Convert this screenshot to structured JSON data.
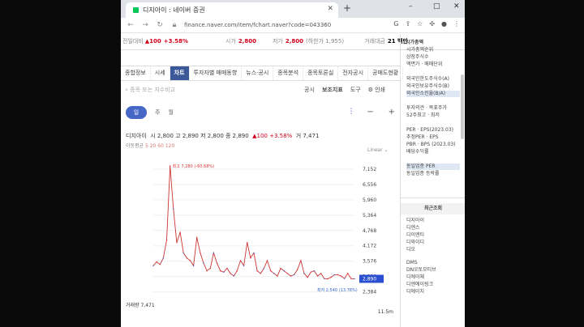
{
  "browser": {
    "tab_title": "디지아이 : 네이버 증권",
    "url": "finance.naver.com/item/fchart.naver?code=043360",
    "new_tab": "+",
    "min": "–",
    "max": "□",
    "close": "✕"
  },
  "header": {
    "prev_close_label": "전일대비",
    "prev_change": "▲100",
    "prev_change_pct": "+3.58%",
    "high_label": "시가",
    "high_value": "2,800",
    "low_label": "저가",
    "low_value": "2,800",
    "low_limit": "(하한가 1,955)",
    "amount_label": "거래대금",
    "amount_value": "21 백만"
  },
  "menu": [
    "종합정보",
    "시세",
    "차트",
    "투자자별 매매동향",
    "뉴스·공시",
    "종목분석",
    "종목토론실",
    "전자공시",
    "공매도현황"
  ],
  "search_placeholder": "종목 또는 지수비교",
  "tools": [
    "공시",
    "보조지표",
    "도구",
    "인쇄"
  ],
  "periods": [
    "일",
    "주",
    "월"
  ],
  "quote": {
    "name": "디지아이",
    "text": "시 2,800  고 2,890  저 2,800  종 2,890",
    "change": "▲100 +3.58%",
    "vol": "거 7,471"
  },
  "ma_label": "이동평균",
  "ma_values": "5  20  60  120",
  "scale": "Linear",
  "volume_label": "거래량 7,471",
  "volume_axis": "11.5m",
  "chart_data": {
    "type": "line",
    "y_ticks": [
      "7,152",
      "6,556",
      "5,960",
      "5,364",
      "4,768",
      "4,172",
      "3,576",
      "2,980",
      "2,384"
    ],
    "ylim": [
      2150,
      7500
    ],
    "max_label": "최고 7,280 (-60.68%)",
    "min_label": "최저 2,540 (13.78%)",
    "last_value": "2,890",
    "series": [
      {
        "values": [
          3400,
          3550,
          3450,
          3700,
          4400,
          7280,
          5600,
          4300,
          4700,
          3900,
          3700,
          3600,
          3400,
          4500,
          3900,
          3500,
          3200,
          3300,
          3900,
          3500,
          3200,
          3150,
          3300,
          3100,
          3000,
          3200,
          3600,
          3400,
          4300,
          3700,
          3900,
          3200,
          3100,
          3300,
          3600,
          3200,
          3100,
          3000,
          3300,
          3200,
          3100,
          3000,
          3050,
          3250,
          3600,
          3100,
          2950,
          3150,
          3200,
          3000,
          3100,
          2900,
          2890,
          2950,
          3050,
          3050,
          3000,
          2900,
          3100,
          2900,
          2890
        ]
      }
    ]
  },
  "right_panel": {
    "sections": [
      {
        "title": "시가총액",
        "lines": [
          "시가총액순위",
          "상장주식수",
          "액면가 · 매매단위"
        ]
      },
      {
        "title": "",
        "lines": [
          "외국인한도주식수(A)",
          "외국인보유주식수(B)",
          "외국인소진율(B/A)"
        ]
      },
      {
        "title": "",
        "lines": [
          "투자의견 · 목표주가",
          "52주최고 · 최저"
        ]
      },
      {
        "title": "",
        "lines": [
          "PER · EPS(2023.03)",
          "추정PER · EPS",
          "PBR · BPS (2023.03)",
          "배당수익률"
        ]
      },
      {
        "title": "",
        "lines": [
          "동일업종 PER",
          "동일업종 등락률"
        ]
      }
    ],
    "recent_title": "최근조회",
    "recent": [
      "디지아이",
      "디엔스",
      "디이엔티",
      "디와이디",
      "디오",
      "DMS",
      "DN오토모티브",
      "디에이체",
      "디엔에이링크",
      "디에이치"
    ]
  }
}
